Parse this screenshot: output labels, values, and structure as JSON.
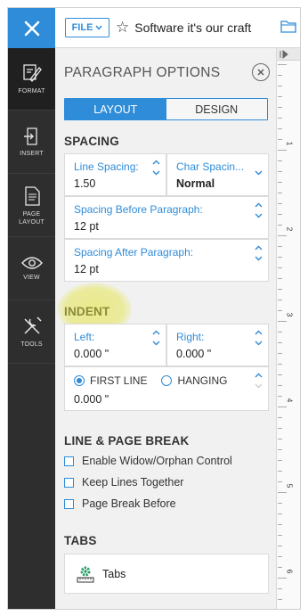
{
  "topbar": {
    "file_label": "FILE",
    "doc_title": "Software it's our craft"
  },
  "rail": {
    "items": [
      {
        "label": "FORMAT",
        "icon": "paintbrush-icon"
      },
      {
        "label": "INSERT",
        "icon": "insert-icon"
      },
      {
        "label": "PAGE LAYOUT",
        "icon": "page-layout-icon"
      },
      {
        "label": "VIEW",
        "icon": "eye-icon"
      },
      {
        "label": "TOOLS",
        "icon": "tools-icon"
      }
    ]
  },
  "panel": {
    "title": "PARAGRAPH OPTIONS",
    "tabs": [
      "LAYOUT",
      "DESIGN"
    ],
    "active_tab": "LAYOUT"
  },
  "spacing": {
    "title": "SPACING",
    "line_spacing_label": "Line Spacing:",
    "line_spacing_value": "1.50",
    "char_spacing_label": "Char Spacin...",
    "char_spacing_value": "Normal",
    "before_label": "Spacing Before Paragraph:",
    "before_value": "12  pt",
    "after_label": "Spacing After Paragraph:",
    "after_value": "12  pt"
  },
  "indent": {
    "title": "INDENT",
    "left_label": "Left:",
    "left_value": "0.000 \"",
    "right_label": "Right:",
    "right_value": "0.000 \"",
    "first_line_label": "FIRST LINE",
    "hanging_label": "HANGING",
    "special_value": "0.000 \"",
    "selected": "FIRST LINE"
  },
  "line_break": {
    "title": "LINE & PAGE BREAK",
    "options": [
      "Enable Widow/Orphan Control",
      "Keep Lines Together",
      "Page Break Before"
    ]
  },
  "tabs_section": {
    "title": "TABS",
    "button_label": "Tabs"
  },
  "ruler": {
    "numbers": [
      "1",
      "2",
      "3",
      "4",
      "5",
      "6"
    ]
  },
  "colors": {
    "accent": "#2f8cd8",
    "rail": "#2e2e2e",
    "panel_bg": "#f1f1f1",
    "highlight": "#e8e878"
  }
}
